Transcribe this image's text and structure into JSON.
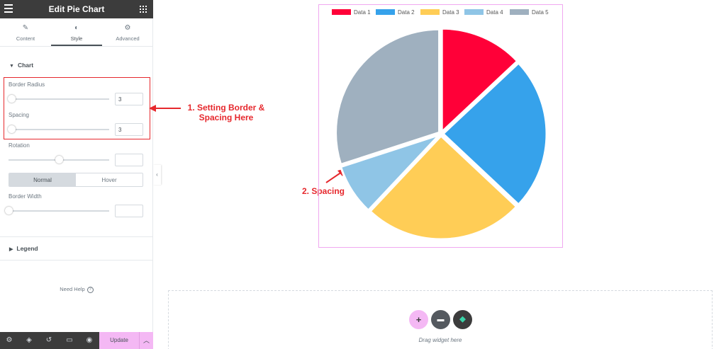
{
  "panel": {
    "title": "Edit Pie Chart",
    "tabs": [
      {
        "label": "Content",
        "icon": "pencil-icon"
      },
      {
        "label": "Style",
        "icon": "contrast-icon"
      },
      {
        "label": "Advanced",
        "icon": "gear-icon"
      }
    ],
    "active_tab": "Style",
    "sections": {
      "chart": "Chart",
      "legend": "Legend"
    },
    "controls": {
      "border_radius": {
        "label": "Border Radius",
        "value": "3"
      },
      "spacing": {
        "label": "Spacing",
        "value": "3"
      },
      "rotation": {
        "label": "Rotation",
        "value": ""
      },
      "state_toggle": {
        "normal": "Normal",
        "hover": "Hover",
        "active": "Normal"
      },
      "border_width": {
        "label": "Border Width",
        "value": ""
      }
    },
    "need_help": "Need Help",
    "footer": {
      "update": "Update",
      "icons": [
        "gear-icon",
        "layers-icon",
        "history-icon",
        "responsive-icon",
        "eye-icon",
        "chevron-up-icon"
      ]
    }
  },
  "annotations": {
    "setting": "1. Setting Border & Spacing Here",
    "setting_line1": "1. Setting Border &",
    "setting_line2": "Spacing Here",
    "spacing": "2. Spacing"
  },
  "chart_data": {
    "type": "pie",
    "categories": [
      "Data 1",
      "Data 2",
      "Data 3",
      "Data 4",
      "Data 5"
    ],
    "values": [
      13,
      24,
      25,
      8,
      30
    ],
    "colors": [
      "#ff0038",
      "#36a2eb",
      "#ffcd56",
      "#8fc5e6",
      "#9fb0bf"
    ],
    "legend_position": "top"
  },
  "drop_zone": {
    "text": "Drag widget here",
    "buttons": [
      {
        "icon": "plus-icon",
        "color": "#f4b8f4"
      },
      {
        "icon": "folder-icon",
        "color": "#54595f"
      },
      {
        "icon": "essential-addons-icon",
        "color": "#3c3c3c"
      }
    ]
  }
}
